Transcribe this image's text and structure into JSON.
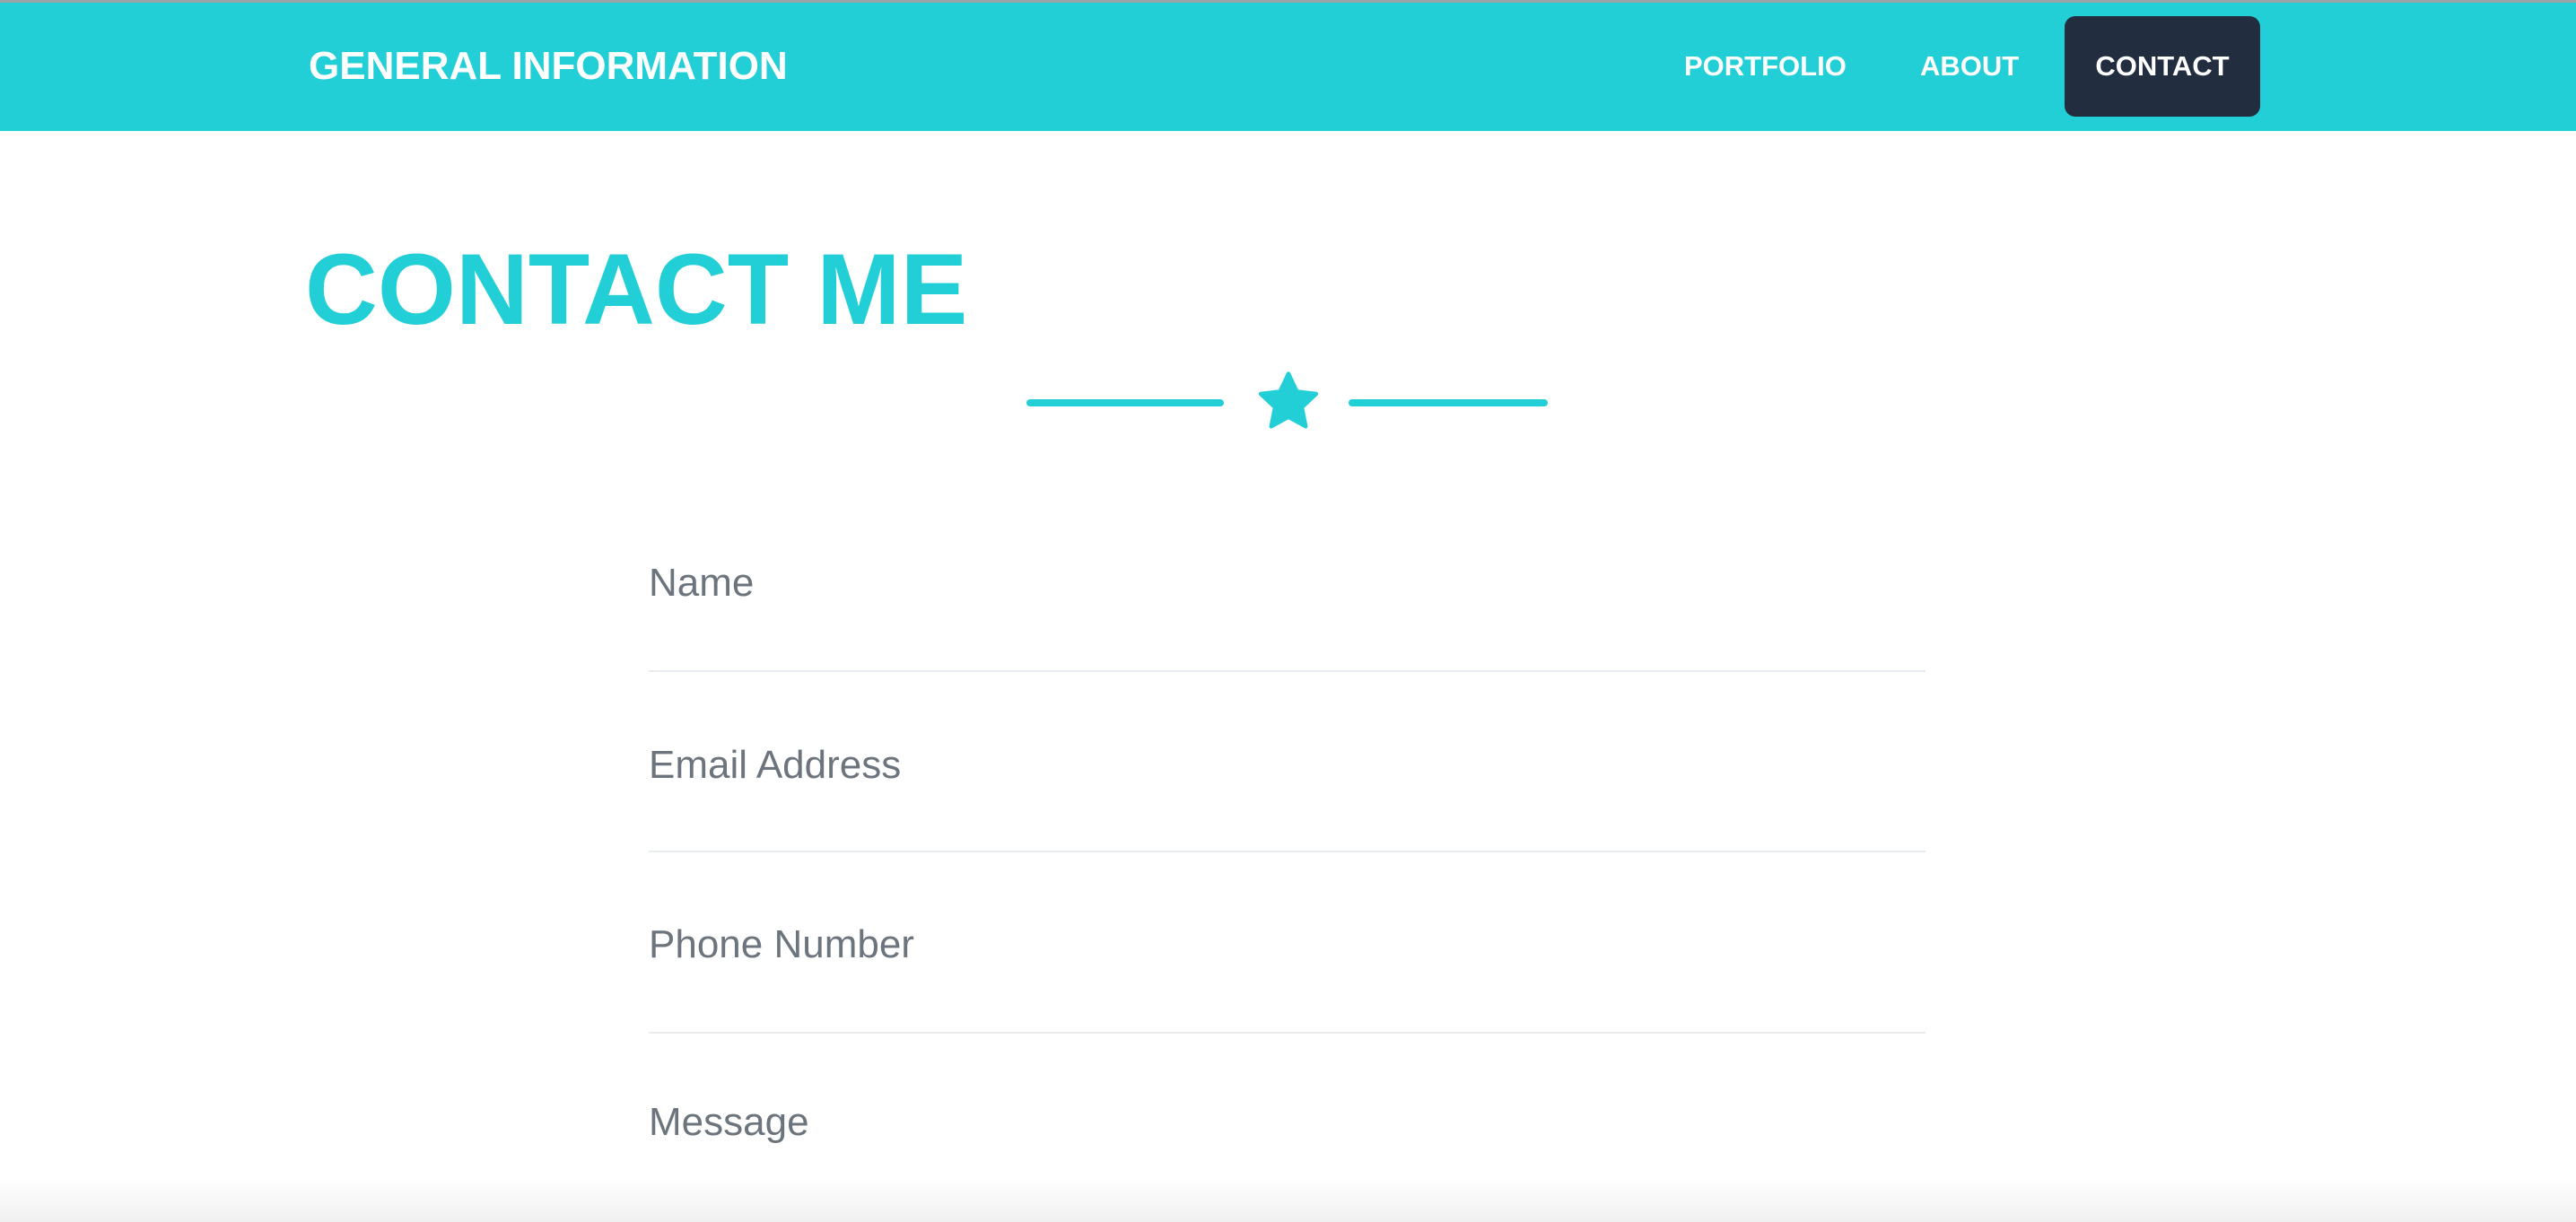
{
  "nav": {
    "brand": "GENERAL INFORMATION",
    "links": [
      "PORTFOLIO",
      "ABOUT"
    ],
    "active": "CONTACT"
  },
  "section": {
    "title": "CONTACT ME",
    "divider_icon": "star-icon"
  },
  "form": {
    "fields": [
      {
        "placeholder": "Name"
      },
      {
        "placeholder": "Email Address"
      },
      {
        "placeholder": "Phone Number"
      },
      {
        "placeholder": "Message"
      }
    ]
  },
  "colors": {
    "primary": "#23cfd6",
    "dark": "#222e40",
    "muted": "#6c757d"
  }
}
